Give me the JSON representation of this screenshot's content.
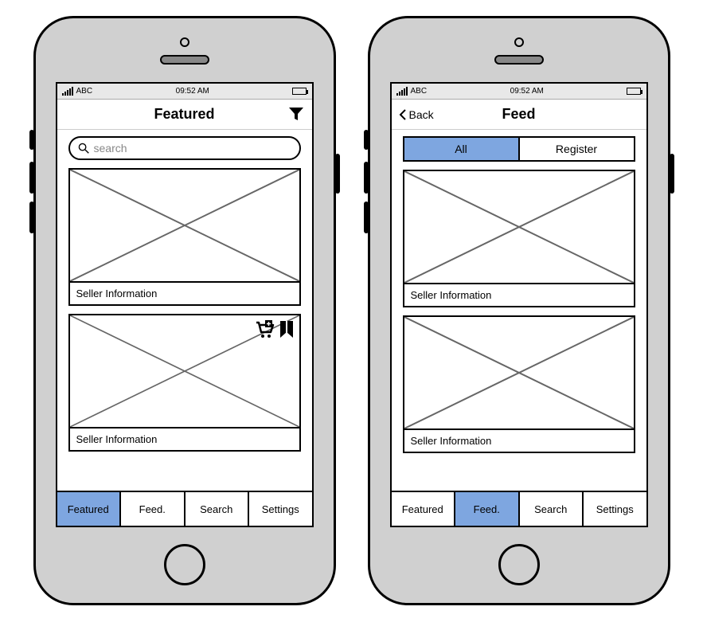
{
  "status": {
    "carrier": "ABC",
    "time": "09:52 AM"
  },
  "tabs": {
    "featured": "Featured",
    "feed": "Feed.",
    "search": "Search",
    "settings": "Settings"
  },
  "phone1": {
    "title": "Featured",
    "search_placeholder": "search",
    "cards": [
      {
        "seller": "Seller Information"
      },
      {
        "seller": "Seller Information"
      }
    ]
  },
  "phone2": {
    "title": "Feed",
    "back": "Back",
    "segments": {
      "all": "All",
      "register": "Register"
    },
    "active_segment": "all",
    "cards": [
      {
        "seller": "Seller Information"
      },
      {
        "seller": "Seller Information"
      }
    ]
  }
}
